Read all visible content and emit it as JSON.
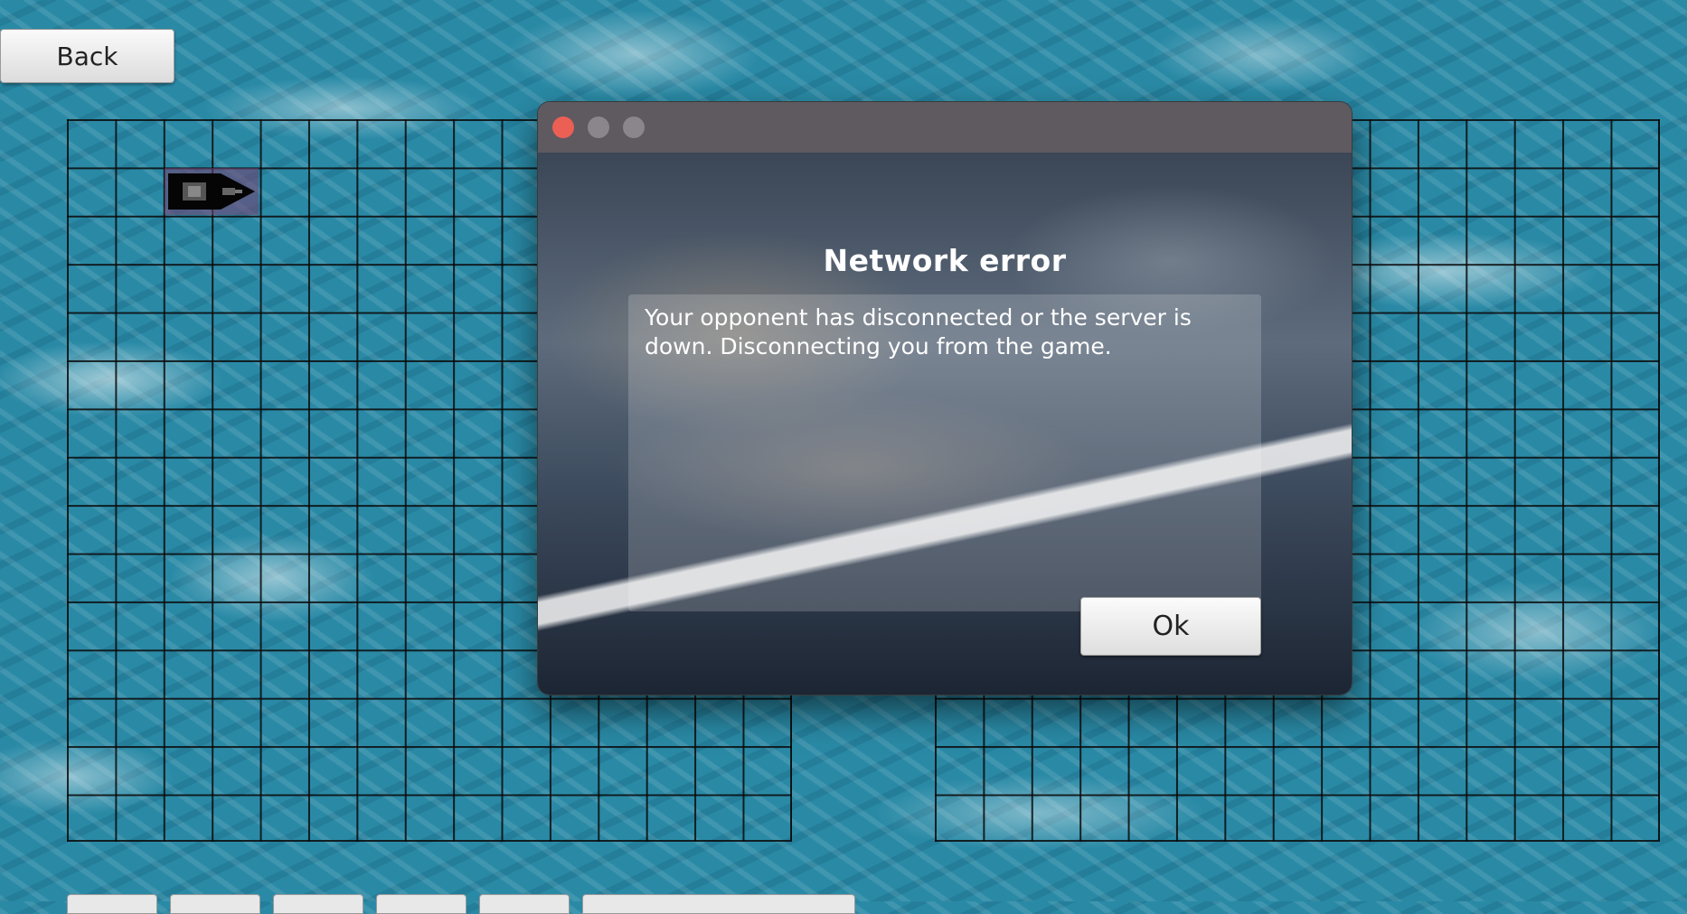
{
  "back_button": {
    "label": "Back"
  },
  "ship": {
    "icon": "ship-icon",
    "color": "#000000"
  },
  "dialog": {
    "title": "Network error",
    "message": "Your opponent has disconnected or the server is down. Disconnecting you from the game.",
    "ok_label": "Ok",
    "titlebar_buttons": [
      "close",
      "minimize",
      "zoom"
    ],
    "close_color": "#ec5f55"
  },
  "colors": {
    "water": "#2a8aa6",
    "titlebar": "#5e5a60"
  }
}
